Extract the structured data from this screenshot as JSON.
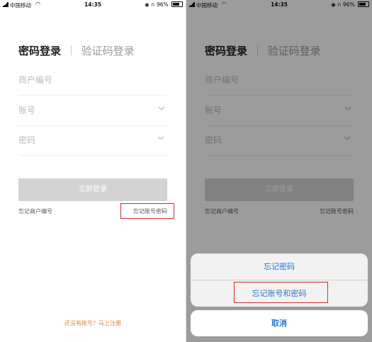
{
  "status_bar": {
    "carrier": "中国移动",
    "time": "14:35",
    "battery": "96%"
  },
  "login": {
    "tab_password": "密码登录",
    "tab_sms": "验证码登录",
    "merchant_placeholder": "商户编号",
    "account_placeholder": "账号",
    "password_placeholder": "密码",
    "login_button": "立即登录",
    "forgot_merchant": "忘记商户编号",
    "forgot_account_password": "忘记账号密码",
    "register_prompt": "还没有账号？马上注册"
  },
  "action_sheet": {
    "options": [
      "忘记密码",
      "忘记账号和密码"
    ],
    "cancel": "取消"
  },
  "colors": {
    "highlight": "#c9302c",
    "sheet_blue": "#2a77cf",
    "register_orange": "#d4883a",
    "button_disabled": "#d3d3d3"
  }
}
